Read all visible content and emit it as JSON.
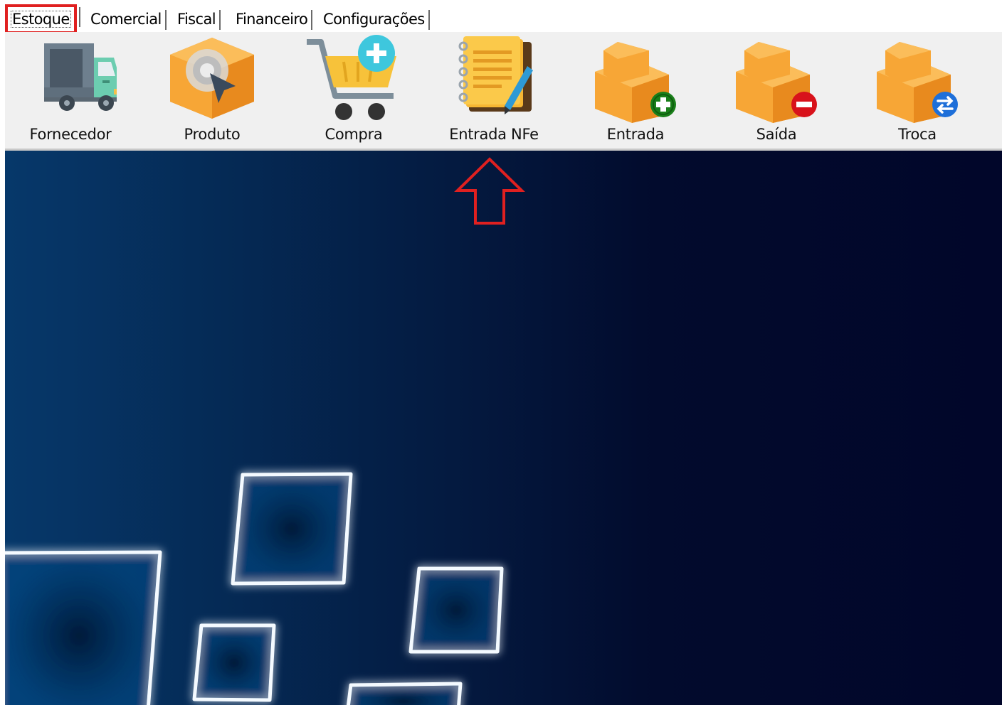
{
  "tabs": [
    {
      "label": "Estoque",
      "active": true
    },
    {
      "label": "Comercial"
    },
    {
      "label": "Fiscal"
    },
    {
      "label": "Financeiro"
    },
    {
      "label": "Configurações"
    }
  ],
  "ribbon": {
    "buttons": [
      {
        "label": "Fornecedor",
        "icon": "truck-icon"
      },
      {
        "label": "Produto",
        "icon": "box-cursor-icon"
      },
      {
        "label": "Compra",
        "icon": "cart-add-icon"
      },
      {
        "label": "Entrada NFe",
        "icon": "notebook-pencil-icon"
      },
      {
        "label": "Entrada",
        "icon": "box-add-icon"
      },
      {
        "label": "Saída",
        "icon": "box-remove-icon"
      },
      {
        "label": "Troca",
        "icon": "box-swap-icon"
      }
    ]
  },
  "annotation": {
    "arrow_target": "Entrada NFe",
    "color": "#e02020"
  },
  "colors": {
    "box": "#f7a636",
    "box_dark": "#e88a1e",
    "add": "#1a7f1a",
    "remove": "#d8121b",
    "swap": "#1e6fd9"
  }
}
